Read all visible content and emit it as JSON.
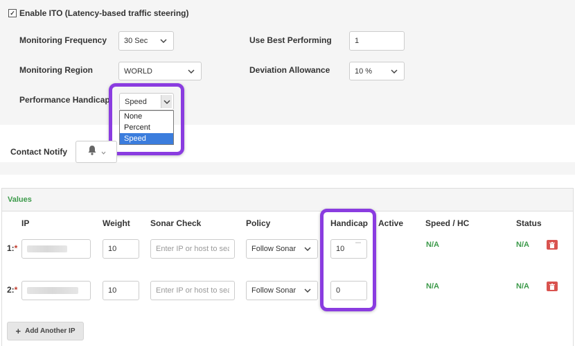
{
  "ito": {
    "checkbox_checked": true,
    "enable_label": "Enable ITO (Latency-based traffic steering)"
  },
  "settings": {
    "monitoring_frequency_label": "Monitoring Frequency",
    "monitoring_frequency_value": "30 Sec",
    "use_best_performing_label": "Use Best Performing",
    "use_best_performing_value": "1",
    "monitoring_region_label": "Monitoring Region",
    "monitoring_region_value": "WORLD",
    "deviation_allowance_label": "Deviation Allowance",
    "deviation_allowance_value": "10 %",
    "performance_handicap_label": "Performance Handicap",
    "performance_handicap_value": "Speed",
    "performance_handicap_options": [
      "None",
      "Percent",
      "Speed"
    ]
  },
  "contact_notify": {
    "label": "Contact Notify",
    "icon": "bell-icon"
  },
  "values": {
    "title": "Values",
    "columns": {
      "ip": "IP",
      "weight": "Weight",
      "sonar_check": "Sonar Check",
      "policy": "Policy",
      "handicap": "Handicap",
      "active": "Active",
      "speed_hc": "Speed / HC",
      "status": "Status"
    },
    "rows": [
      {
        "num": "1:",
        "required": "*",
        "weight": "10",
        "sonar_placeholder": "Enter IP or host to search",
        "policy": "Follow Sonar",
        "handicap": "10",
        "speed_hc": "N/A",
        "status": "N/A"
      },
      {
        "num": "2:",
        "required": "*",
        "weight": "10",
        "sonar_placeholder": "Enter IP or host to search",
        "policy": "Follow Sonar",
        "handicap": "0",
        "speed_hc": "N/A",
        "status": "N/A"
      }
    ],
    "add_button_label": "Add Another IP"
  },
  "colors": {
    "highlight": "#8a3ce0",
    "green_text": "#3c9a4a",
    "delete_red": "#d9534f",
    "selected_option": "#3b7ddd"
  }
}
